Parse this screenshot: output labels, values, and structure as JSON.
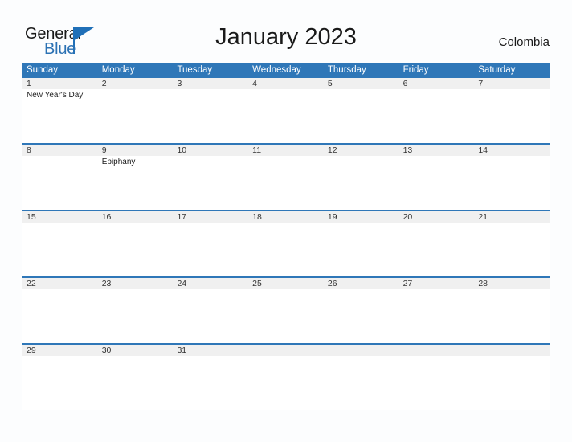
{
  "brand": {
    "name_part1": "General",
    "name_part2": "Blue",
    "triangle_icon": "triangle-logo-icon",
    "accent_color": "#2070b8"
  },
  "header": {
    "title": "January 2023",
    "region": "Colombia"
  },
  "colors": {
    "header_blue": "#2f77b8",
    "rule_blue": "#2f77b8",
    "date_band_gray": "#f0f0f0",
    "page_background": "#fcfdfe",
    "cell_white": "#ffffff",
    "text_dark": "#1a1a1a"
  },
  "calendar": {
    "month": "January",
    "year": "2023",
    "weekday_headers": [
      "Sunday",
      "Monday",
      "Tuesday",
      "Wednesday",
      "Thursday",
      "Friday",
      "Saturday"
    ],
    "weeks": [
      {
        "days": [
          {
            "date": "1",
            "event": "New Year's Day"
          },
          {
            "date": "2",
            "event": ""
          },
          {
            "date": "3",
            "event": ""
          },
          {
            "date": "4",
            "event": ""
          },
          {
            "date": "5",
            "event": ""
          },
          {
            "date": "6",
            "event": ""
          },
          {
            "date": "7",
            "event": ""
          }
        ]
      },
      {
        "days": [
          {
            "date": "8",
            "event": ""
          },
          {
            "date": "9",
            "event": "Epiphany"
          },
          {
            "date": "10",
            "event": ""
          },
          {
            "date": "11",
            "event": ""
          },
          {
            "date": "12",
            "event": ""
          },
          {
            "date": "13",
            "event": ""
          },
          {
            "date": "14",
            "event": ""
          }
        ]
      },
      {
        "days": [
          {
            "date": "15",
            "event": ""
          },
          {
            "date": "16",
            "event": ""
          },
          {
            "date": "17",
            "event": ""
          },
          {
            "date": "18",
            "event": ""
          },
          {
            "date": "19",
            "event": ""
          },
          {
            "date": "20",
            "event": ""
          },
          {
            "date": "21",
            "event": ""
          }
        ]
      },
      {
        "days": [
          {
            "date": "22",
            "event": ""
          },
          {
            "date": "23",
            "event": ""
          },
          {
            "date": "24",
            "event": ""
          },
          {
            "date": "25",
            "event": ""
          },
          {
            "date": "26",
            "event": ""
          },
          {
            "date": "27",
            "event": ""
          },
          {
            "date": "28",
            "event": ""
          }
        ]
      },
      {
        "days": [
          {
            "date": "29",
            "event": ""
          },
          {
            "date": "30",
            "event": ""
          },
          {
            "date": "31",
            "event": ""
          },
          {
            "date": "",
            "event": ""
          },
          {
            "date": "",
            "event": ""
          },
          {
            "date": "",
            "event": ""
          },
          {
            "date": "",
            "event": ""
          }
        ]
      }
    ]
  }
}
